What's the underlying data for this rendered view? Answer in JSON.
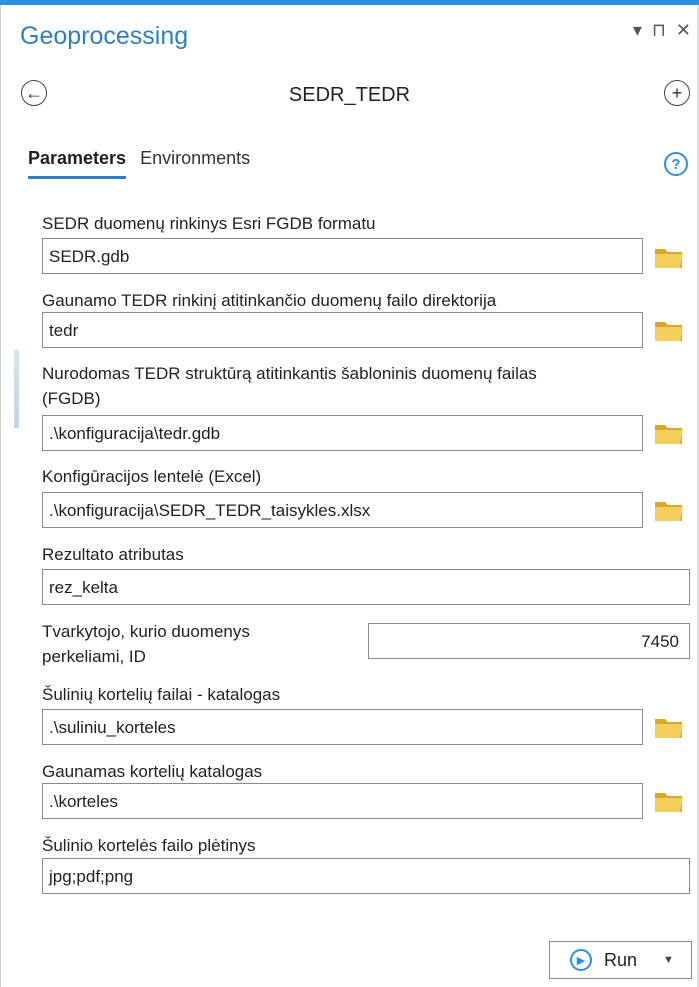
{
  "pane": {
    "title": "Geoprocessing",
    "controls": [
      "▾",
      "⊓",
      "✕"
    ]
  },
  "tool": {
    "title": "SEDR_TEDR"
  },
  "tabs": [
    {
      "label": "Parameters",
      "active": true
    },
    {
      "label": "Environments",
      "active": false
    }
  ],
  "params": [
    {
      "label": "SEDR duomenų rinkinys Esri FGDB formatu",
      "value": "SEDR.gdb",
      "browse": true
    },
    {
      "label": "Gaunamo TEDR rinkinį atitinkančio duomenų failo direktorija",
      "value": "tedr",
      "browse": true
    },
    {
      "label": "Nurodomas TEDR struktūrą atitinkantis šabloninis duomenų failas",
      "label2": "(FGDB)",
      "value": ".\\konfiguracija\\tedr.gdb",
      "browse": true
    },
    {
      "label": "Konfigūracijos lentelė (Excel)",
      "value": ".\\konfiguracija\\SEDR_TEDR_taisykles.xlsx",
      "browse": true
    },
    {
      "label": "Rezultato atributas",
      "value": "rez_kelta",
      "browse": false
    },
    {
      "label": "Tvarkytojo, kurio duomenys",
      "label2": "perkeliami, ID",
      "value": "7450",
      "browse": false
    },
    {
      "label": "Šulinių kortelių failai - katalogas",
      "value": ".\\suliniu_korteles",
      "browse": true
    },
    {
      "label": "Gaunamas kortelių katalogas",
      "value": ".\\korteles",
      "browse": true
    },
    {
      "label": "Šulinio kortelės failo plėtinys",
      "value": "jpg;pdf;png",
      "browse": false
    }
  ],
  "run": {
    "label": "Run"
  },
  "colors": {
    "accent": "#2f7fc1",
    "folder": "#e8c54a"
  }
}
